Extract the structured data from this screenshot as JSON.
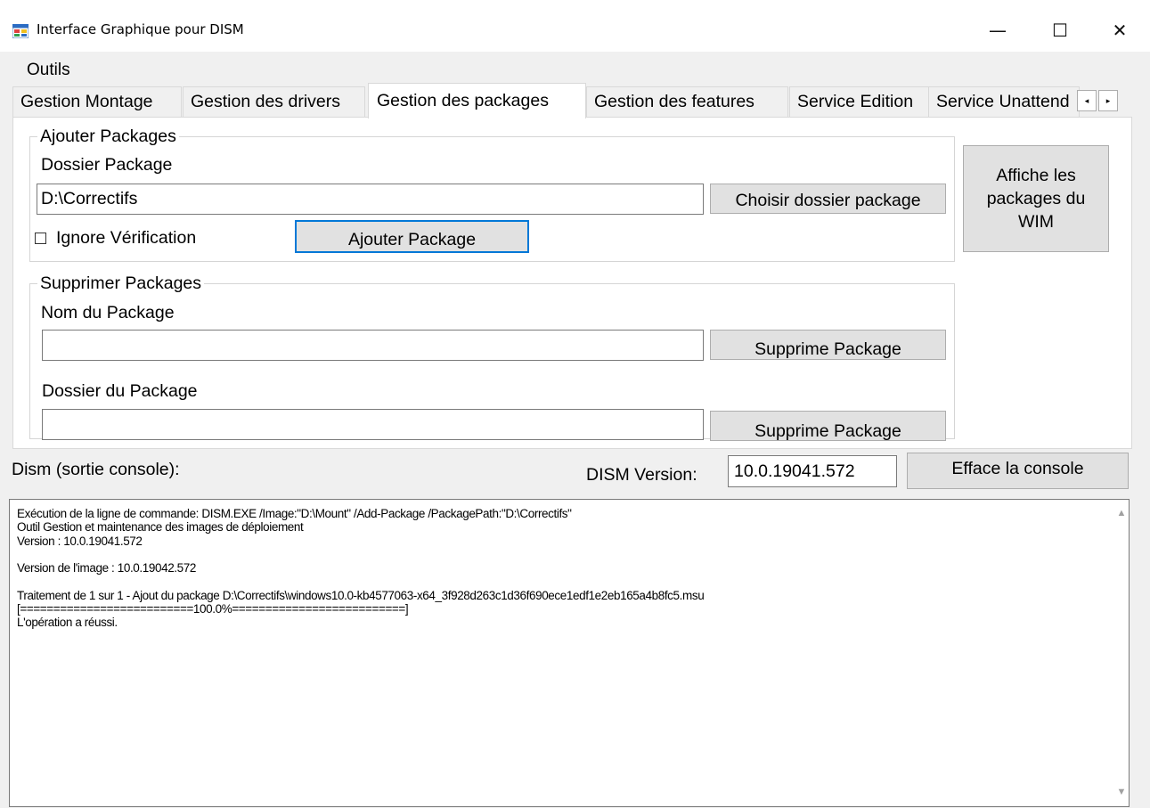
{
  "window": {
    "title": "Interface Graphique pour DISM",
    "minimize_glyph": "—",
    "maximize_glyph": "☐",
    "close_glyph": "✕",
    "app_icon": "window-app-icon"
  },
  "menu": {
    "items": [
      {
        "label": "Outils"
      }
    ]
  },
  "tabs": {
    "items": [
      {
        "label": "Gestion Montage"
      },
      {
        "label": "Gestion des drivers"
      },
      {
        "label": "Gestion des packages",
        "active": true
      },
      {
        "label": "Gestion des features"
      },
      {
        "label": "Service Edition"
      },
      {
        "label": "Service Unattend"
      }
    ],
    "scroll_left_glyph": "◂",
    "scroll_right_glyph": "▸"
  },
  "add_group": {
    "legend": "Ajouter Packages",
    "folder_label": "Dossier Package",
    "folder_value": "D:\\Correctifs",
    "choose_button": "Choisir dossier package",
    "ignore_checkbox_label": "Ignore Vérification",
    "ignore_checked": false,
    "add_button": "Ajouter Package"
  },
  "show_packages_button": "Affiche les packages du WIM",
  "remove_group": {
    "legend": "Supprimer Packages",
    "name_label": "Nom du Package",
    "name_value": "",
    "remove_button_1": "Supprime Package",
    "folder_label": "Dossier du Package",
    "folder_value": "",
    "remove_button_2": "Supprime Package"
  },
  "console": {
    "label": "Dism (sortie console):",
    "dism_version_label": "DISM Version:",
    "dism_version_value": "10.0.19041.572",
    "clear_button": "Efface la console",
    "output": "Exécution de la ligne de commande: DISM.EXE /Image:\"D:\\Mount\" /Add-Package /PackagePath:\"D:\\Correctifs\"\nOutil Gestion et maintenance des images de déploiement\nVersion : 10.0.19041.572\n\nVersion de l'image : 10.0.19042.572\n\nTraitement de 1 sur 1 - Ajout du package D:\\Correctifs\\windows10.0-kb4577063-x64_3f928d263c1d36f690ece1edf1e2eb165a4b8fc5.msu\n[==========================100.0%==========================]\nL'opération a réussi.",
    "scroll_up_glyph": "▲",
    "scroll_down_glyph": "▼"
  },
  "colors": {
    "window_bg": "#f0f0f0",
    "panel_bg": "#ffffff",
    "button_bg": "#e1e1e1",
    "focus_border": "#0078d7"
  }
}
